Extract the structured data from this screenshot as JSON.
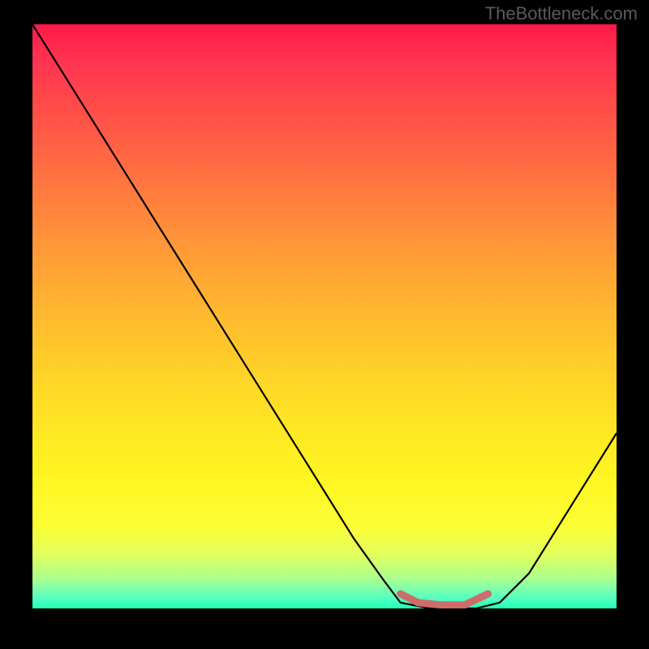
{
  "watermark": "TheBottleneck.com",
  "chart_data": {
    "type": "line",
    "title": "",
    "xlabel": "",
    "ylabel": "",
    "xlim": [
      0,
      100
    ],
    "ylim": [
      0,
      100
    ],
    "x": [
      0,
      5,
      10,
      15,
      20,
      25,
      30,
      35,
      40,
      45,
      50,
      55,
      60,
      63,
      68,
      72,
      76,
      80,
      85,
      90,
      95,
      100
    ],
    "y": [
      100,
      92,
      84,
      76,
      68,
      60,
      52,
      44,
      36,
      28,
      20,
      12,
      5,
      1,
      0,
      0,
      0,
      1,
      6,
      14,
      22,
      30
    ],
    "highlight_segment": {
      "color": "#cf6b6b",
      "x": [
        63,
        66,
        70,
        74,
        78
      ],
      "y": [
        2.5,
        1,
        0.6,
        0.6,
        2.5
      ]
    },
    "background_gradient": {
      "top": "#ff1a4a",
      "bottom": "#22ffb4"
    }
  }
}
